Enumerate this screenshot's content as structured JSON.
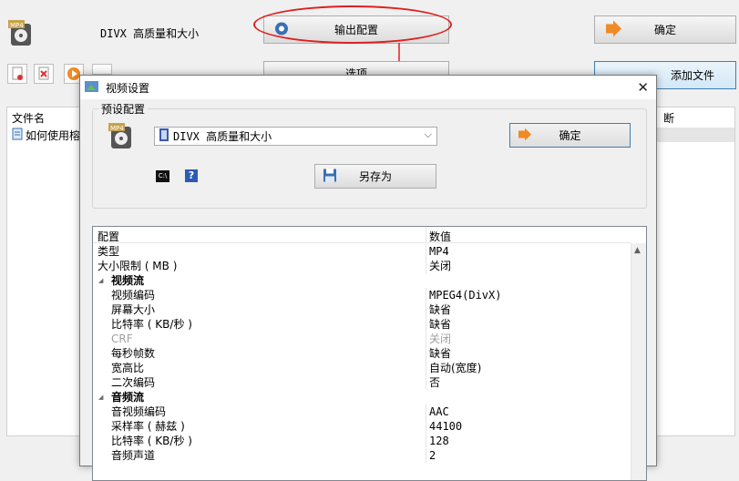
{
  "main": {
    "preset_label": "DIVX 高质量和大小",
    "output_config_button": "输出配置",
    "options_button": "选项",
    "ok_button": "确定",
    "add_file_button": "添加文件",
    "file_list": {
      "column_filename": "文件名",
      "column_partial": "断",
      "first_file": "如何使用榕"
    }
  },
  "dialog": {
    "title": "视频设置",
    "group_label": "预设配置",
    "preset_select": "DIVX 高质量和大小",
    "ok_button": "确定",
    "save_as_button": "另存为",
    "grid_header": {
      "col1": "配置",
      "col2": "数值"
    },
    "rows": [
      {
        "k": "类型",
        "v": "MP4",
        "mono": true
      },
      {
        "k": "大小限制 ( MB )",
        "v": "关闭"
      },
      {
        "k": "视频流",
        "v": "",
        "cat": true
      },
      {
        "k": "视频编码",
        "v": "MPEG4(DivX)",
        "mono": true
      },
      {
        "k": "屏幕大小",
        "v": "缺省"
      },
      {
        "k": "比特率 ( KB/秒 )",
        "v": "缺省"
      },
      {
        "k": "CRF",
        "v": "关闭",
        "disabled": true
      },
      {
        "k": "每秒帧数",
        "v": "缺省"
      },
      {
        "k": "宽高比",
        "v": "自动(宽度)"
      },
      {
        "k": "二次编码",
        "v": "否"
      },
      {
        "k": "音频流",
        "v": "",
        "cat": true
      },
      {
        "k": "音视频编码",
        "v": "AAC",
        "mono": true
      },
      {
        "k": "采样率 ( 赫兹 )",
        "v": "44100",
        "mono": true
      },
      {
        "k": "比特率 ( KB/秒 )",
        "v": "128",
        "mono": true
      },
      {
        "k": "音频声道",
        "v": "2",
        "mono": true
      }
    ]
  }
}
